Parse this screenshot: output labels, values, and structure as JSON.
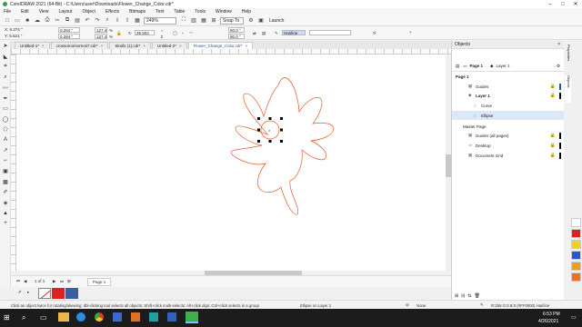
{
  "window": {
    "title": "CorelDRAW 2021 (64-Bit) - C:\\Users\\user\\Downloads\\Flower_Change_Color.cdr*",
    "min": "–",
    "max": "□",
    "close": "✕"
  },
  "menu": [
    "File",
    "Edit",
    "View",
    "Layout",
    "Object",
    "Effects",
    "Bitmaps",
    "Text",
    "Table",
    "Tools",
    "Window",
    "Help"
  ],
  "toolbar": {
    "zoom": "249%",
    "snap": "Snap To",
    "launch": "Launch"
  },
  "props": {
    "x": "X: 6.274 \"",
    "y": "Y: 5.521 \"",
    "w": "0.284 \"",
    "h": "0.284 \"",
    "sw": "127.4",
    "sh": "127.4",
    "pct": "%",
    "rot": "39.553",
    "a1": "90.0 °",
    "a2": "90.0 °",
    "outline": "Hairline"
  },
  "tabs": [
    {
      "label": "Untitled-1*",
      "active": false
    },
    {
      "label": "crossomomomoti7.cdr*",
      "active": false
    },
    {
      "label": "Skulls (1).cdr*",
      "active": false
    },
    {
      "label": "Untitled-2*",
      "active": false
    },
    {
      "label": "Flower_Change_Color.cdr*",
      "active": true
    }
  ],
  "page": {
    "count": "1 of 1",
    "tab": "Page 1"
  },
  "docker": {
    "title": "Objects",
    "page_label": "Page 1",
    "layer_label": "Layer 1",
    "tree": [
      {
        "label": "Page 1",
        "indent": 2,
        "bold": true,
        "selected": false
      },
      {
        "label": "Guides",
        "indent": 24,
        "bold": false,
        "selected": false
      },
      {
        "label": "Layer 1",
        "indent": 24,
        "bold": true,
        "selected": false
      },
      {
        "label": "Curve",
        "indent": 30,
        "bold": false,
        "selected": false
      },
      {
        "label": "Ellipse",
        "indent": 30,
        "bold": false,
        "selected": true
      },
      {
        "label": "Master Page",
        "indent": 10,
        "bold": false,
        "selected": false
      },
      {
        "label": "Guides (all pages)",
        "indent": 24,
        "bold": false,
        "selected": false
      },
      {
        "label": "Desktop",
        "indent": 24,
        "bold": false,
        "selected": false
      },
      {
        "label": "Document Grid",
        "indent": 24,
        "bold": false,
        "selected": false
      }
    ],
    "side_tabs": [
      "Properties",
      "Objects"
    ]
  },
  "status": {
    "hint": "Click an object twice for rotating/skewing; dbl-clicking tool selects all objects; Shift+click multi-selects; Alt+click digs; Ctrl+click selects in a group",
    "object": "Ellipse on Layer 1",
    "fill": "None",
    "outline": "R:255 G:0 B:0 (#FF0000)  Hairline"
  },
  "taskbar": {
    "time": "6:53 PM",
    "date": "4/26/2021"
  },
  "colors": {
    "accent": "#2255aa",
    "outline": "#e8552f"
  },
  "palette": [
    "#ffffff",
    "#e02020",
    "#f2d21a",
    "#2a57c8",
    "#e8a020",
    "#f07020"
  ],
  "doc_palette": [
    "#ffffff",
    "#e02020",
    "#3a5fa0"
  ]
}
